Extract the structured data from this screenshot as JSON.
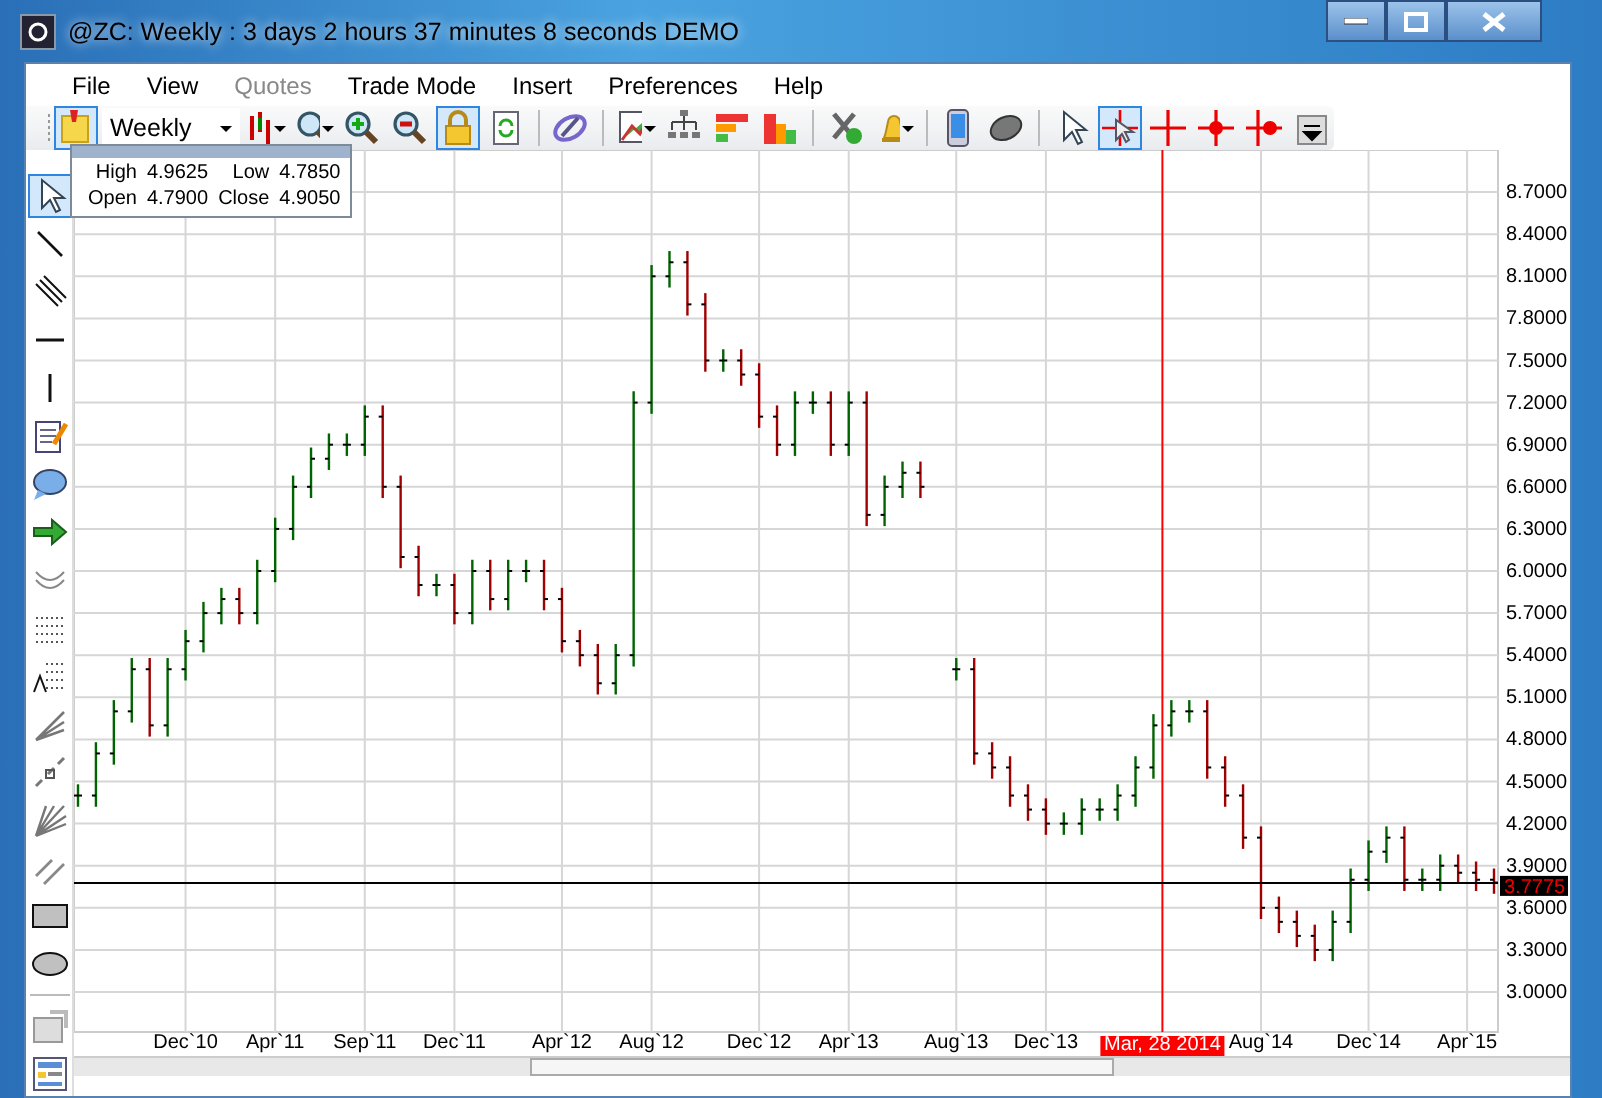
{
  "window": {
    "title": "@ZC: Weekly : 3 days 2 hours 37 minutes 8 seconds DEMO"
  },
  "menu": [
    {
      "label": "File",
      "disabled": false
    },
    {
      "label": "View",
      "disabled": false
    },
    {
      "label": "Quotes",
      "disabled": true
    },
    {
      "label": "Trade Mode",
      "disabled": false
    },
    {
      "label": "Insert",
      "disabled": false
    },
    {
      "label": "Preferences",
      "disabled": false
    },
    {
      "label": "Help",
      "disabled": false
    }
  ],
  "toolbar": {
    "period": "Weekly",
    "tools": [
      {
        "kind": "pin",
        "selected": true
      },
      {
        "kind": "period"
      },
      {
        "kind": "bars",
        "selected": false
      },
      {
        "kind": "zoom",
        "selected": false
      },
      {
        "kind": "zoomin",
        "selected": false
      },
      {
        "kind": "zoomout",
        "selected": false
      },
      {
        "kind": "lock",
        "selected": true
      },
      {
        "kind": "refresh",
        "selected": false
      },
      {
        "kind": "sep"
      },
      {
        "kind": "swirl",
        "selected": false
      },
      {
        "kind": "sep"
      },
      {
        "kind": "indicator",
        "selected": false
      },
      {
        "kind": "tree",
        "selected": false
      },
      {
        "kind": "heat",
        "selected": false
      },
      {
        "kind": "columns",
        "selected": false
      },
      {
        "kind": "sep"
      },
      {
        "kind": "tools",
        "selected": false
      },
      {
        "kind": "bell",
        "selected": false
      },
      {
        "kind": "sep"
      },
      {
        "kind": "phone",
        "selected": false
      },
      {
        "kind": "mouse",
        "selected": false
      },
      {
        "kind": "sep"
      },
      {
        "kind": "cursor",
        "selected": false
      },
      {
        "kind": "crosscursor",
        "selected": true
      },
      {
        "kind": "cross",
        "selected": false
      },
      {
        "kind": "crossdot",
        "selected": false
      },
      {
        "kind": "crossdotright",
        "selected": false
      },
      {
        "kind": "more",
        "selected": false
      }
    ]
  },
  "drawing_tools": [
    {
      "kind": "cursor",
      "selected": true
    },
    {
      "kind": "line",
      "selected": false
    },
    {
      "kind": "parallel",
      "selected": false
    },
    {
      "kind": "hline",
      "selected": false
    },
    {
      "kind": "vline",
      "selected": false
    },
    {
      "kind": "note",
      "selected": false
    },
    {
      "kind": "callout",
      "selected": false
    },
    {
      "kind": "arrow",
      "selected": false
    },
    {
      "kind": "arc",
      "selected": false
    },
    {
      "kind": "grid",
      "selected": false
    },
    {
      "kind": "fib",
      "selected": false
    },
    {
      "kind": "fan",
      "selected": false
    },
    {
      "kind": "gann",
      "selected": false
    },
    {
      "kind": "fan2",
      "selected": false
    },
    {
      "kind": "channel",
      "selected": false
    },
    {
      "kind": "rect",
      "selected": false
    },
    {
      "kind": "ellipse",
      "selected": false
    },
    {
      "kind": "sep"
    },
    {
      "kind": "chartbox",
      "selected": false
    },
    {
      "kind": "template",
      "selected": false
    }
  ],
  "info": [
    {
      "label": "High",
      "value": "4.9625"
    },
    {
      "label": "Low",
      "value": "4.7850"
    },
    {
      "label": "Open",
      "value": "4.7900"
    },
    {
      "label": "Close",
      "value": "4.9050"
    }
  ],
  "chart": {
    "price_axis": [
      "8.7000",
      "8.4000",
      "8.1000",
      "7.8000",
      "7.5000",
      "7.2000",
      "6.9000",
      "6.6000",
      "6.3000",
      "6.0000",
      "5.7000",
      "5.4000",
      "5.1000",
      "4.8000",
      "4.5000",
      "4.2000",
      "3.9000",
      "3.6000",
      "3.3000",
      "3.0000"
    ],
    "date_axis": [
      "Dec`10",
      "Apr`11",
      "Sep`11",
      "Dec`11",
      "Apr`12",
      "Aug`12",
      "Dec`12",
      "Apr`13",
      "Aug`13",
      "Dec`13",
      "Aug`14",
      "Dec`14",
      "Apr`15"
    ],
    "crosshair_date": "Mar, 28 2014",
    "last_price": "3.7775"
  }
}
